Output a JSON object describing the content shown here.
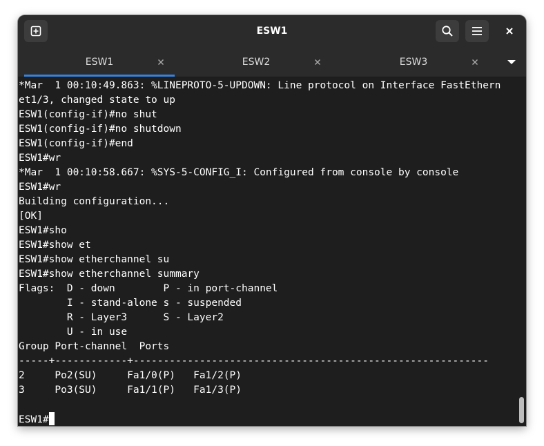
{
  "window": {
    "title": "ESW1"
  },
  "tabs": [
    {
      "label": "ESW1",
      "active": true
    },
    {
      "label": "ESW2",
      "active": false
    },
    {
      "label": "ESW3",
      "active": false
    }
  ],
  "icons": {
    "new_tab": "new-tab-icon",
    "search": "search-icon",
    "menu": "hamburger-menu-icon",
    "close": "close-icon",
    "tab_close": "tab-close-icon",
    "tab_list": "chevron-down-icon"
  },
  "colors": {
    "accent": "#3584e4",
    "terminal_bg": "#1e1e1e",
    "terminal_fg": "#ffffff",
    "header_bg": "#2b2b2b"
  },
  "terminal": {
    "lines": [
      "*Mar  1 00:10:49.863: %LINEPROTO-5-UPDOWN: Line protocol on Interface FastEthern",
      "et1/3, changed state to up",
      "ESW1(config-if)#no shut",
      "ESW1(config-if)#no shutdown",
      "ESW1(config-if)#end",
      "ESW1#wr",
      "*Mar  1 00:10:58.667: %SYS-5-CONFIG_I: Configured from console by console",
      "ESW1#wr",
      "Building configuration...",
      "[OK]",
      "ESW1#sho",
      "ESW1#show et",
      "ESW1#show etherchannel su",
      "ESW1#show etherchannel summary",
      "Flags:  D - down        P - in port-channel",
      "        I - stand-alone s - suspended",
      "        R - Layer3      S - Layer2",
      "        U - in use",
      "Group Port-channel  Ports",
      "-----+------------+-----------------------------------------------------------",
      "2     Po2(SU)     Fa1/0(P)   Fa1/2(P)",
      "3     Po3(SU)     Fa1/1(P)   Fa1/3(P)",
      ""
    ],
    "prompt": "ESW1#"
  }
}
